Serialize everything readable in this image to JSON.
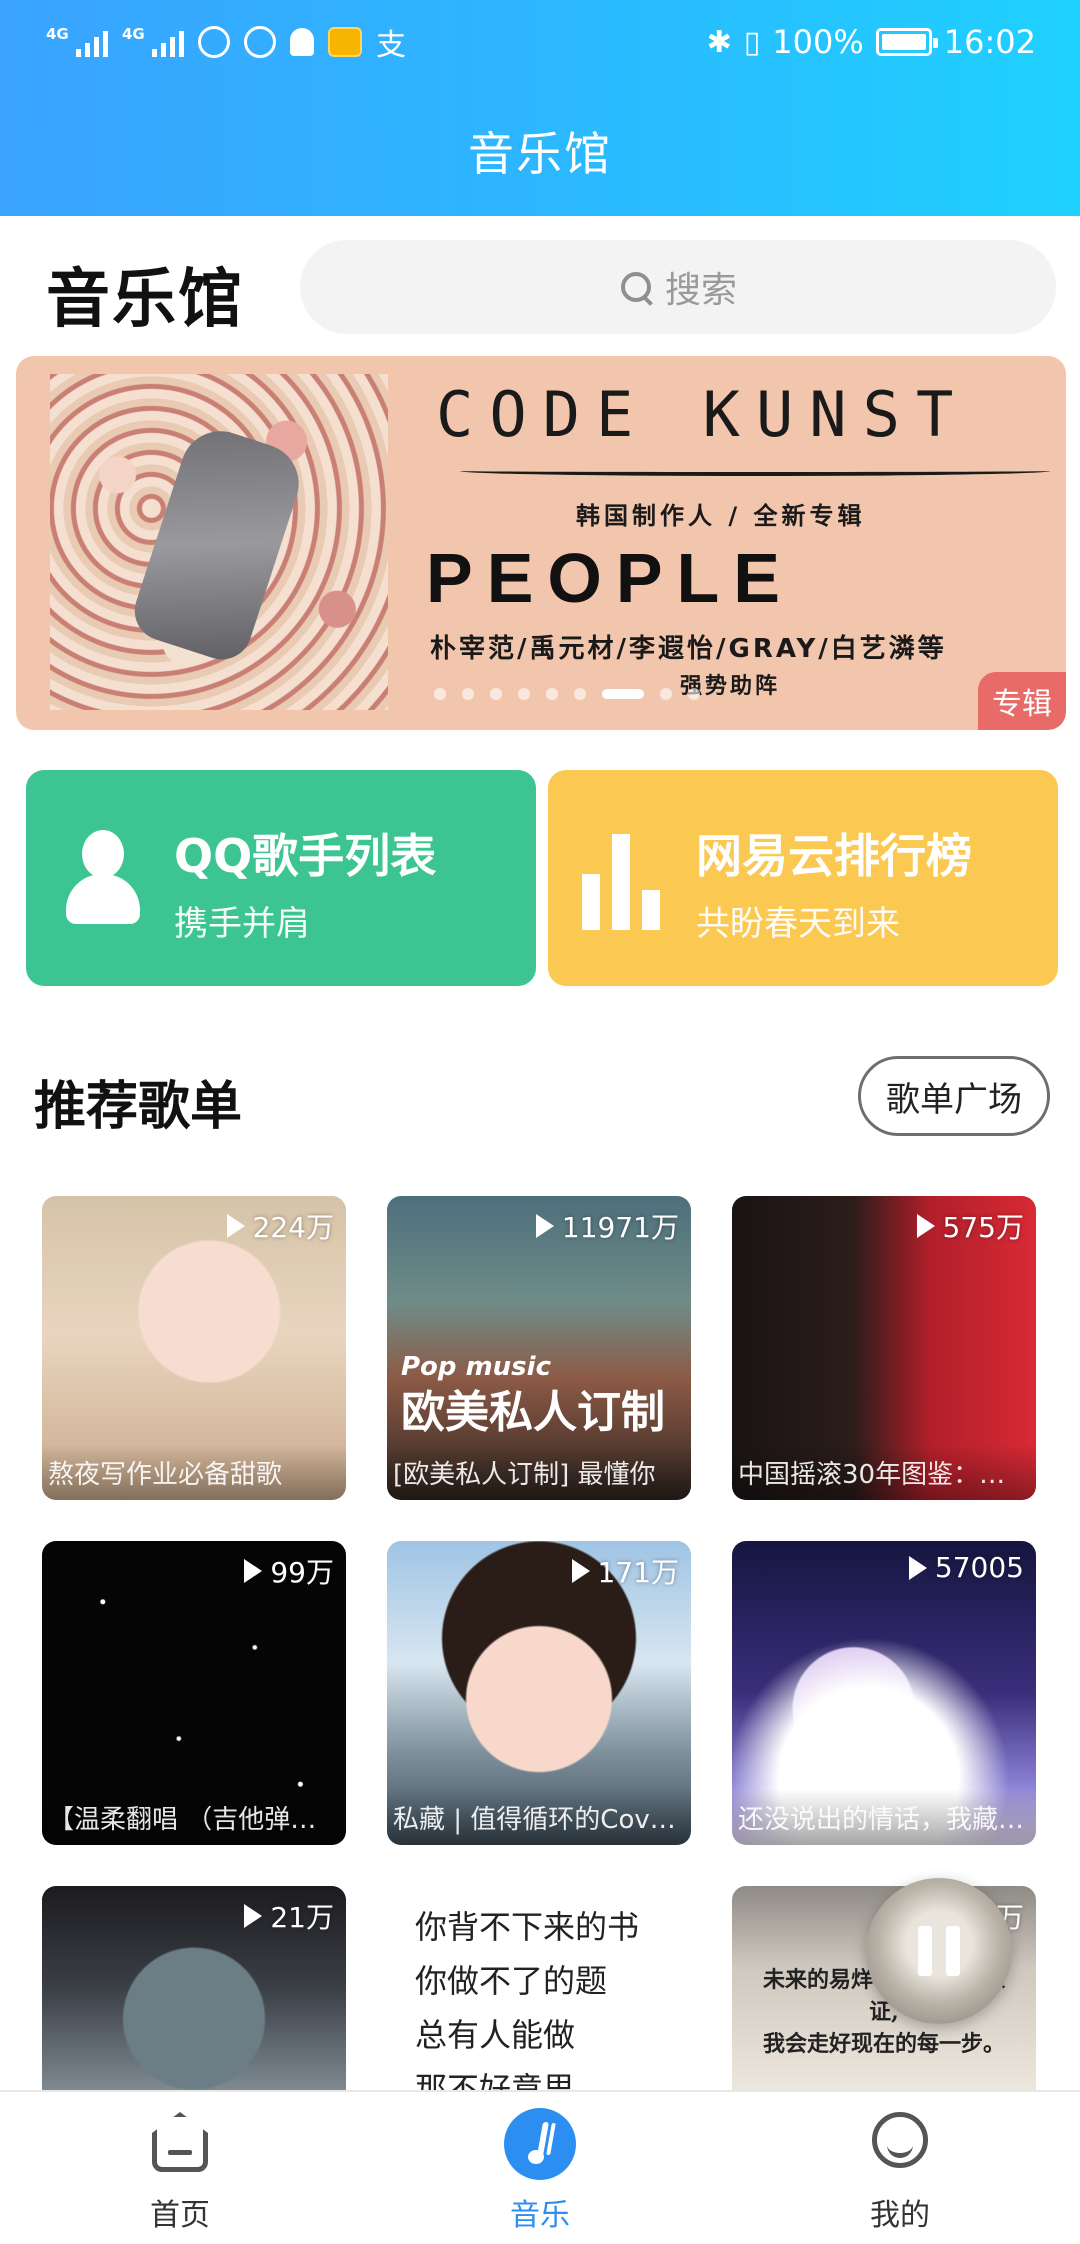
{
  "status_bar": {
    "network_1": "4G",
    "network_2": "4G",
    "battery": "100%",
    "time": "16:02",
    "icons": [
      "signal-icon",
      "signal-icon",
      "hotspot-icon",
      "alarm-icon",
      "bell-icon",
      "mail-icon",
      "alipay-icon",
      "bluetooth-icon",
      "vibrate-icon",
      "battery-icon"
    ]
  },
  "header": {
    "title": "音乐馆"
  },
  "page": {
    "title": "音乐馆"
  },
  "search": {
    "placeholder": "搜索"
  },
  "banner": {
    "line1": "CODE KUNST",
    "line2": "韩国制作人 / 全新专辑",
    "line3": "PEOPLE",
    "line4": "朴宰范/禹元材/李遐怡/GRAY/白艺潾等",
    "line5": "强势助阵",
    "badge": "专辑",
    "dots_total": 9,
    "dots_active_index": 6
  },
  "cards": [
    {
      "title": "QQ歌手列表",
      "subtitle": "携手并肩",
      "color": "#3cc592",
      "icon": "person-icon"
    },
    {
      "title": "网易云排行榜",
      "subtitle": "共盼春天到来",
      "color": "#fbc852",
      "icon": "bar-chart-icon"
    }
  ],
  "section": {
    "title": "推荐歌单",
    "button": "歌单广场"
  },
  "playlists": [
    {
      "count": "224万",
      "caption": "熬夜写作业必备甜歌"
    },
    {
      "count": "11971万",
      "caption": "[欧美私人订制] 最懂你",
      "overlay_small": "Pop music",
      "overlay": "欧美私人订制"
    },
    {
      "count": "575万",
      "caption": "中国摇滚30年图鉴：永…"
    },
    {
      "count": "99万",
      "caption": "【温柔翻唱 （吉他弹…"
    },
    {
      "count": "171万",
      "caption": "私藏 | 值得循环的Cove…"
    },
    {
      "count": "57005",
      "caption": "还没说出的情话，我藏…"
    },
    {
      "count": "21万",
      "caption": ""
    },
    {
      "count": "",
      "caption": "",
      "poem": [
        "你背不下来的书",
        "你做不了的题",
        "总有人能做",
        "那不好意思"
      ]
    },
    {
      "count": "万",
      "caption": "",
      "inscription": [
        "未来的易烊千玺我向你保证,",
        "我会走好现在的每一步。"
      ]
    }
  ],
  "bottom_nav": [
    {
      "label": "首页",
      "icon": "home-icon"
    },
    {
      "label": "音乐",
      "icon": "music-note-icon",
      "active": true
    },
    {
      "label": "我的",
      "icon": "smiley-icon"
    }
  ]
}
